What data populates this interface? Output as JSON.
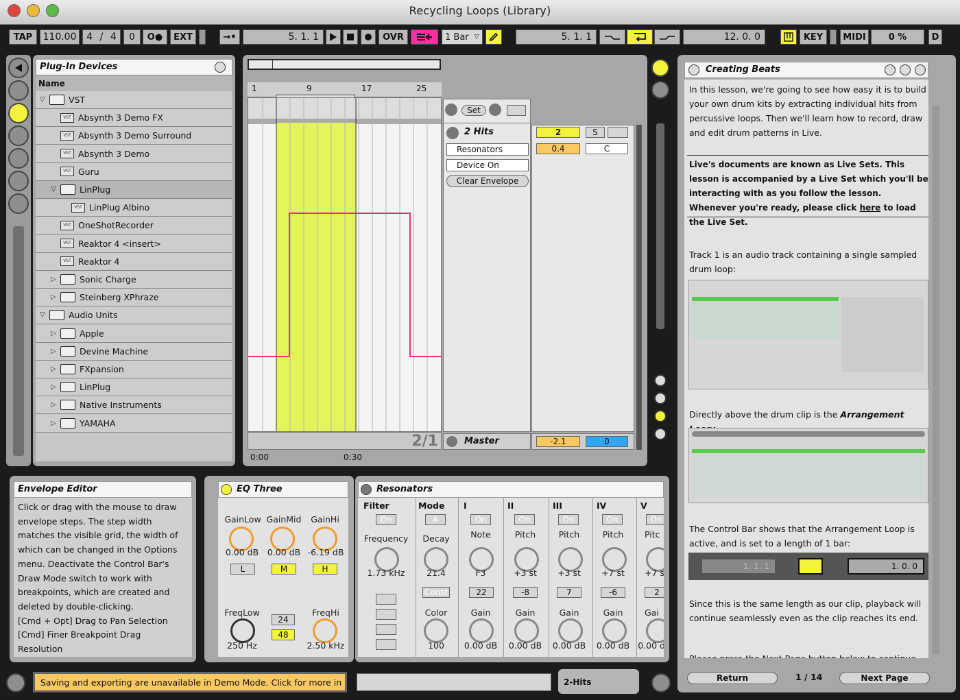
{
  "window": {
    "title": "Recycling Loops (Library)"
  },
  "control_bar": {
    "tap": "TAP",
    "tempo": "110.00",
    "sig_num": "4",
    "sig_slash": "/",
    "sig_den": "4",
    "metro_count": "0",
    "metro_icon": "O●",
    "ext": "EXT",
    "follow": "→•",
    "position": "5.  1.  1",
    "ovr": "OVR",
    "quantize": "1 Bar",
    "loop_start": "5.  1.  1",
    "loop_len": "12.  0.  0",
    "key": "KEY",
    "midi": "MIDI",
    "cpu": "0 %",
    "disk": "D"
  },
  "browser": {
    "title": "Plug-In Devices",
    "col_name": "Name",
    "items": [
      {
        "label": "VST",
        "kind": "folder",
        "open": true,
        "indent": 0
      },
      {
        "label": "Absynth 3 Demo FX",
        "kind": "vst",
        "indent": 1
      },
      {
        "label": "Absynth 3 Demo Surround",
        "kind": "vst",
        "indent": 1
      },
      {
        "label": "Absynth 3 Demo",
        "kind": "vst",
        "indent": 1
      },
      {
        "label": "Guru",
        "kind": "vst",
        "indent": 1
      },
      {
        "label": "LinPlug",
        "kind": "folder",
        "open": true,
        "indent": 1,
        "selected": true
      },
      {
        "label": "LinPlug Albino",
        "kind": "vst",
        "indent": 2
      },
      {
        "label": "OneShotRecorder",
        "kind": "vst",
        "indent": 1
      },
      {
        "label": "Reaktor 4 <insert>",
        "kind": "vst",
        "indent": 1
      },
      {
        "label": "Reaktor 4",
        "kind": "vst",
        "indent": 1
      },
      {
        "label": "Sonic Charge",
        "kind": "folder",
        "indent": 1
      },
      {
        "label": "Steinberg XPhraze",
        "kind": "folder",
        "indent": 1
      },
      {
        "label": "Audio Units",
        "kind": "folder",
        "open": true,
        "indent": 0
      },
      {
        "label": "Apple",
        "kind": "folder",
        "indent": 1
      },
      {
        "label": "Devine Machine",
        "kind": "folder",
        "indent": 1
      },
      {
        "label": "FXpansion",
        "kind": "folder",
        "indent": 1
      },
      {
        "label": "LinPlug",
        "kind": "folder",
        "indent": 1
      },
      {
        "label": "Native Instruments",
        "kind": "folder",
        "indent": 1
      },
      {
        "label": "YAMAHA",
        "kind": "folder",
        "indent": 1
      }
    ]
  },
  "arrangement": {
    "ruler": [
      "1",
      "9",
      "17",
      "25"
    ],
    "time_labels": [
      "0:00",
      "0:30"
    ],
    "zoom": "2/1",
    "set_label": "Set",
    "track_name": "2 Hits",
    "device_select": "Resonators",
    "param_select": "Device On",
    "clear_env": "Clear Envelope",
    "track_num": "2",
    "solo": "S",
    "volume": "0.4",
    "pan": "C",
    "master_name": "Master",
    "master_vol": "-2.1",
    "master_pan": "0"
  },
  "info": {
    "title": "Envelope Editor",
    "text": "Click or drag with the mouse to draw envelope steps. The step width matches the visible grid, the width of which can be changed in the Options menu. Deactivate the Control Bar's Draw Mode switch to work with breakpoints, which are created and deleted by double-clicking.\n[Cmd + Opt] Drag to Pan Selection\n[Cmd] Finer Breakpoint Drag\nResolution"
  },
  "eq": {
    "title": "EQ Three",
    "gainlow": "GainLow",
    "gainmid": "GainMid",
    "gainhi": "GainHi",
    "v_low": "0.00 dB",
    "v_mid": "0.00 dB",
    "v_hi": "-6.19 dB",
    "l": "L",
    "m": "M",
    "h": "H",
    "freqlow": "FreqLow",
    "freqhi": "FreqHi",
    "v_fl": "250 Hz",
    "v_fh": "2.50 kHz",
    "s24": "24",
    "s48": "48"
  },
  "resonators": {
    "title": "Resonators",
    "filter": "Filter",
    "on": "On",
    "frequency": "Frequency",
    "freq_val": "1.73 kHz",
    "mode": "Mode",
    "mode_val": "A",
    "decay": "Decay",
    "decay_val": "21.4",
    "const": "Const",
    "color": "Color",
    "color_val": "100",
    "i": "I",
    "note": "Note",
    "note_val": "F3",
    "i_n": "22",
    "i_gain": "Gain",
    "i_gain_val": "0.00 dB",
    "ii": "II",
    "iii": "III",
    "iv": "IV",
    "v": "V",
    "pitch": "Pitch",
    "ii_p": "+3 st",
    "iii_p": "+3 st",
    "iv_p": "+7 st",
    "v_p": "+7 s",
    "ii_n": "-8",
    "iii_n": "7",
    "iv_n": "-6",
    "v_n": "2",
    "gain": "Gain",
    "gv": "0.00 dB",
    "gv_cut": "0.00 d",
    "gain_cut": "Gai",
    "pitch_cut": "Pitc"
  },
  "status": {
    "message": "Saving and exporting are unavailable in Demo Mode. Click for more in",
    "track": "2-Hits"
  },
  "lesson": {
    "title": "Creating Beats",
    "p1": "In this lesson, we're going to see how easy it is to build your own drum kits by extracting individual hits from percussive loops. Then we'll learn how to record, draw and edit drum patterns in Live.",
    "p2a": "Live's documents are known as Live Sets. This lesson is accompanied by a Live Set which you'll be interacting with as you follow the lesson. Whenever you're ready, please click ",
    "p2link": "here",
    "p2b": " to load the Live Set.",
    "p3": "Track 1 is an audio track containing a single sampled drum loop:",
    "p4a": "Directly above the drum clip is the ",
    "p4b": "Arrangement Loop:",
    "p5": "The Control Bar shows that the Arrangement Loop is active, and is set to a length of 1 bar:",
    "cb_pos": "1.   1.   1",
    "cb_len": "1.   0.   0",
    "p6": "Since this is the same length as our clip, playback will continue seamlessly even as the clip reaches its end.",
    "p7": "Please press the Next Page button below to continue",
    "return": "Return",
    "page": "1 / 14",
    "next": "Next Page"
  }
}
